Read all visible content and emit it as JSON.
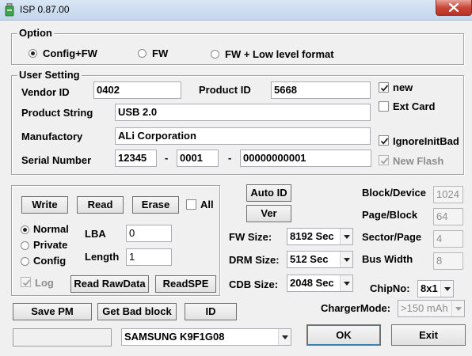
{
  "window": {
    "title": "ISP 0.87.00"
  },
  "option": {
    "label": "Option",
    "config_fw": "Config+FW",
    "fw": "FW",
    "fw_low_level": "FW + Low level format"
  },
  "user_setting": {
    "label": "User Setting",
    "vendor_id_label": "Vendor ID",
    "vendor_id": "0402",
    "product_id_label": "Product ID",
    "product_id": "5668",
    "product_string_label": "Product String",
    "product_string": "USB 2.0",
    "manufactory_label": "Manufactory",
    "manufactory": "ALi Corporation",
    "serial_label": "Serial Number",
    "serial_1": "12345",
    "serial_dash_1": "-",
    "serial_2": "0001",
    "serial_dash_2": "-",
    "serial_3": "00000000001",
    "new_label": "new",
    "ext_card_label": "Ext Card",
    "ignore_init_bad_label": "IgnoreInitBad",
    "new_flash_label": "New Flash"
  },
  "rw_panel": {
    "write": "Write",
    "read": "Read",
    "erase": "Erase",
    "all": "All",
    "normal": "Normal",
    "private": "Private",
    "config": "Config",
    "lba_label": "LBA",
    "lba": "0",
    "length_label": "Length",
    "length": "1",
    "log": "Log",
    "read_raw": "Read RawData",
    "read_spe": "ReadSPE"
  },
  "middle": {
    "auto_id": "Auto ID",
    "ver": "Ver",
    "fw_size_label": "FW Size:",
    "fw_size": "8192 Sec",
    "drm_size_label": "DRM Size:",
    "drm_size": "512 Sec",
    "cdb_size_label": "CDB Size:",
    "cdb_size": "2048 Sec"
  },
  "right": {
    "block_device_label": "Block/Device",
    "block_device": "1024",
    "page_block_label": "Page/Block",
    "page_block": "64",
    "sector_page_label": "Sector/Page",
    "sector_page": "4",
    "bus_width_label": "Bus Width",
    "bus_width": "8",
    "chipno_label": "ChipNo:",
    "chipno": "8x1",
    "charger_label": "ChargerMode:",
    "charger": ">150 mAh"
  },
  "bottom": {
    "save_pm": "Save PM",
    "get_bad_block": "Get Bad block",
    "id": "ID",
    "status": "",
    "flash": "SAMSUNG K9F1G08",
    "ok": "OK",
    "exit": "Exit"
  }
}
